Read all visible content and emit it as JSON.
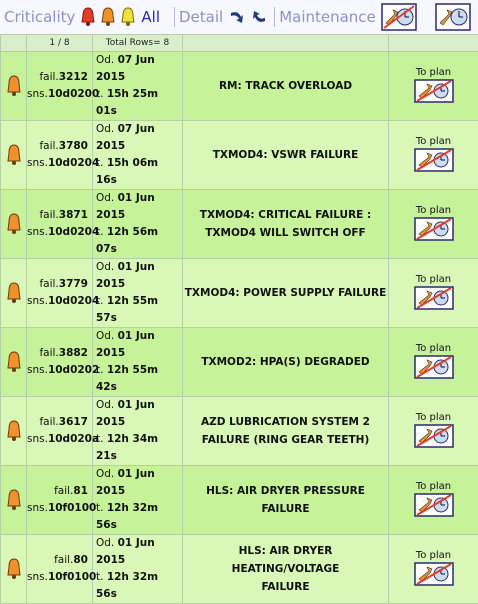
{
  "toolbar": {
    "criticality_label": "Criticality",
    "all_label": "All",
    "detail_label": "Detail",
    "maintenance_label": "Maintenance"
  },
  "colors": {
    "red": "#e53b2a",
    "orange": "#f0922a",
    "yellow": "#f0e23a",
    "row_a": "#c6f39a",
    "row_b": "#d9f7b6"
  },
  "table": {
    "page": "1 / 8",
    "total": "Total Rows= 8",
    "rows": [
      {
        "fail": "3212",
        "sns": "10d0200",
        "date": "07 Jun 2015",
        "time": "15h 25m 01s",
        "msg1": "RM: TRACK OVERLOAD",
        "msg2": "",
        "plan": "To plan"
      },
      {
        "fail": "3780",
        "sns": "10d0204",
        "date": "07 Jun 2015",
        "time": "15h 06m 16s",
        "msg1": "TXMOD4: VSWR FAILURE",
        "msg2": "",
        "plan": "To plan"
      },
      {
        "fail": "3871",
        "sns": "10d0204",
        "date": "01 Jun 2015",
        "time": "12h 56m 07s",
        "msg1": "TXMOD4: CRITICAL FAILURE :",
        "msg2": "TXMOD4 WILL SWITCH OFF",
        "plan": "To plan"
      },
      {
        "fail": "3779",
        "sns": "10d0204",
        "date": "01 Jun 2015",
        "time": "12h 55m 57s",
        "msg1": "TXMOD4: POWER SUPPLY FAILURE",
        "msg2": "",
        "plan": "To plan"
      },
      {
        "fail": "3882",
        "sns": "10d0202",
        "date": "01 Jun 2015",
        "time": "12h 55m 42s",
        "msg1": "TXMOD2: HPA(S) DEGRADED",
        "msg2": "",
        "plan": "To plan"
      },
      {
        "fail": "3617",
        "sns": "10d020a",
        "date": "01 Jun 2015",
        "time": "12h 34m 21s",
        "msg1": "AZD LUBRICATION SYSTEM 2",
        "msg2": "FAILURE (RING GEAR TEETH)",
        "plan": "To plan"
      },
      {
        "fail": "81",
        "sns": "10f0100",
        "date": "01 Jun 2015",
        "time": "12h 32m 56s",
        "msg1": "HLS: AIR DRYER PRESSURE FAILURE",
        "msg2": "",
        "plan": "To plan"
      },
      {
        "fail": "80",
        "sns": "10f0100",
        "date": "01 Jun 2015",
        "time": "12h 32m 56s",
        "msg1": "HLS: AIR DRYER HEATING/VOLTAGE",
        "msg2": "FAILURE",
        "plan": "To plan"
      }
    ]
  },
  "labels": {
    "fail_prefix": "fail.",
    "sns_prefix": "sns.",
    "date_prefix": "Od.",
    "time_prefix": "t."
  }
}
